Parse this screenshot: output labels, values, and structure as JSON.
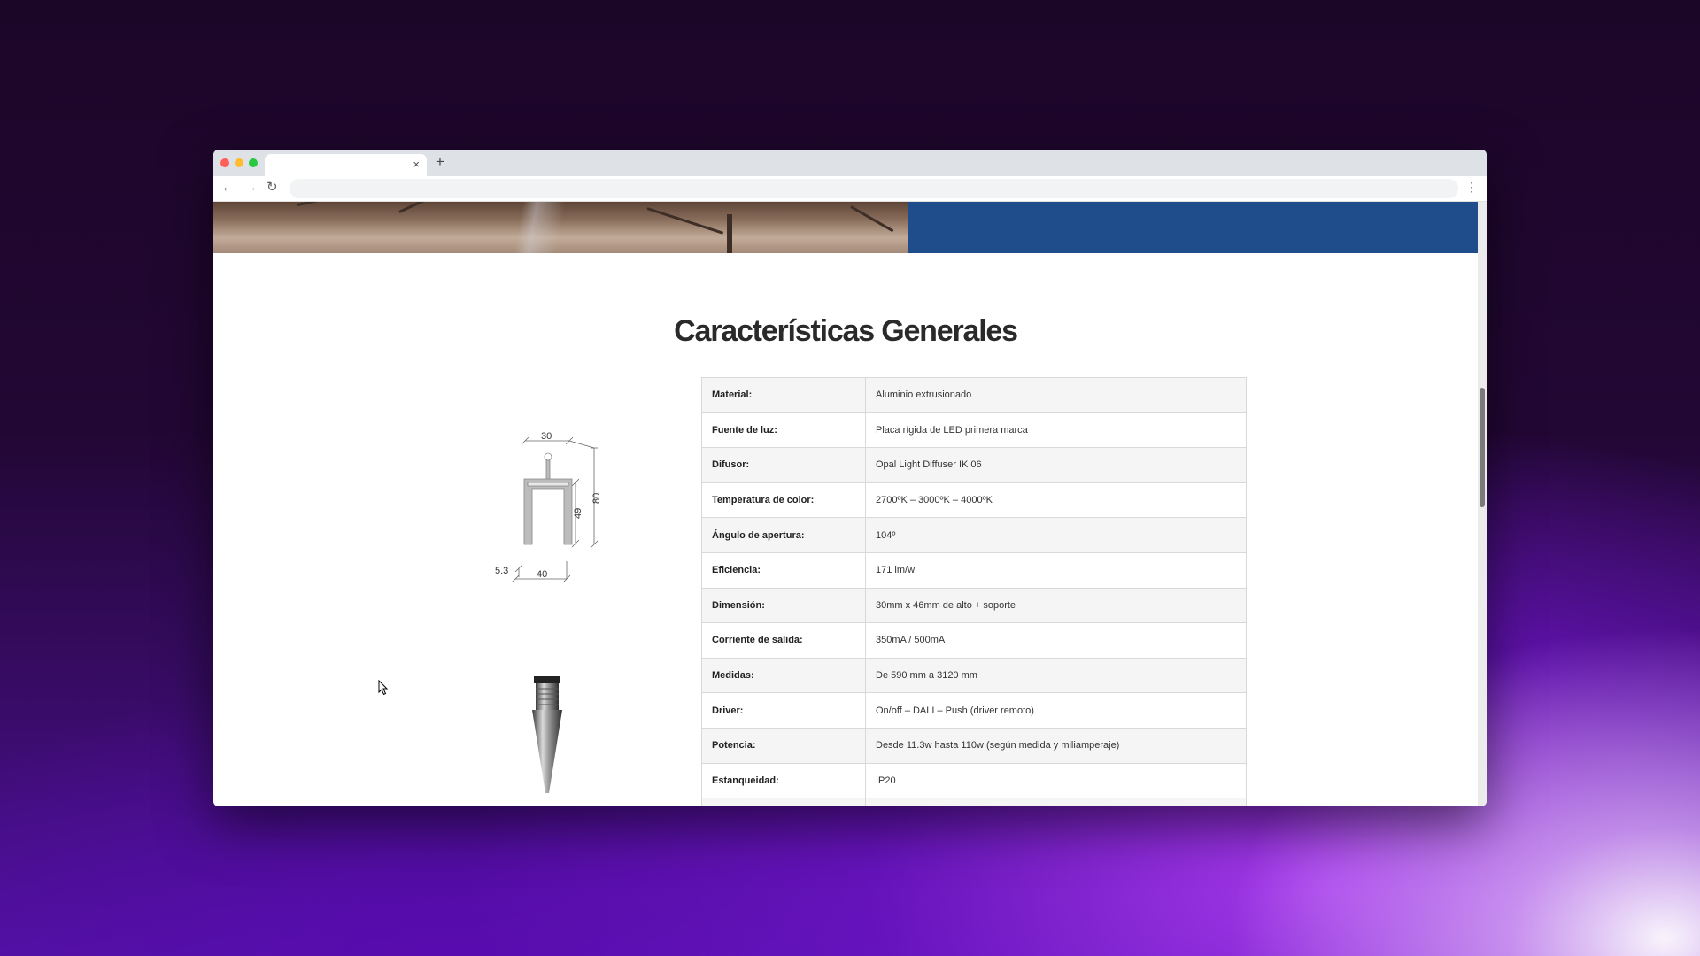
{
  "browser": {
    "tab_title": "",
    "tab_close": "×",
    "new_tab": "+",
    "back": "←",
    "forward": "→",
    "reload": "↻",
    "address_value": "",
    "menu": "⋮"
  },
  "page": {
    "heading": "Características Generales",
    "specs": [
      {
        "label": "Material:",
        "value": "Aluminio extrusionado"
      },
      {
        "label": "Fuente de luz:",
        "value": "Placa rígida de LED primera marca"
      },
      {
        "label": "Difusor:",
        "value": "Opal Light Diffuser IK 06"
      },
      {
        "label": "Temperatura de color:",
        "value": "2700ºK – 3000ºK – 4000ºK"
      },
      {
        "label": "Ángulo de apertura:",
        "value": "104º"
      },
      {
        "label": "Eficiencia:",
        "value": "171 lm/w"
      },
      {
        "label": "Dimensión:",
        "value": "30mm x 46mm de alto + soporte"
      },
      {
        "label": "Corriente de salida:",
        "value": "350mA / 500mA"
      },
      {
        "label": "Medidas:",
        "value": "De 590 mm a 3120 mm"
      },
      {
        "label": "Driver:",
        "value": "On/off – DALI – Push (driver remoto)"
      },
      {
        "label": "Potencia:",
        "value": "Desde 11.3w hasta 110w (según medida y miliamperaje)"
      },
      {
        "label": "Estanqueidad:",
        "value": "IP20"
      },
      {
        "label": "",
        "value": ""
      }
    ],
    "diagram_labels": {
      "top_width": "30",
      "height_total": "80",
      "height_body": "49",
      "side": "5.3",
      "bottom_width": "40"
    }
  },
  "colors": {
    "hero_blue": "#1f4d8c",
    "heading": "#2a2a2a"
  }
}
